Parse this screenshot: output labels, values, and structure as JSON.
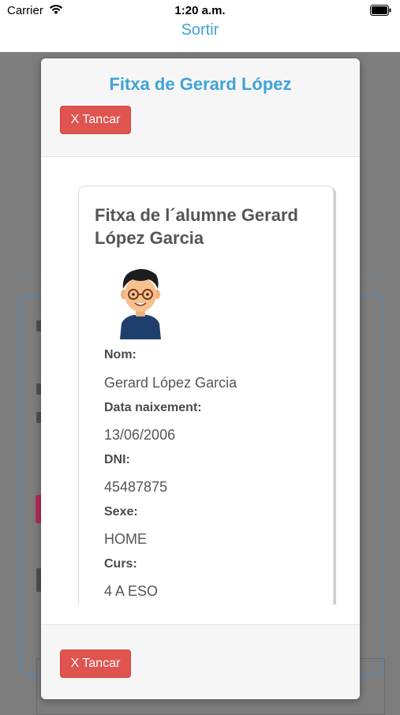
{
  "status_bar": {
    "carrier": "Carrier",
    "time": "1:20 a.m."
  },
  "nav": {
    "sortir_label": "Sortir"
  },
  "modal": {
    "title": "Fitxa de Gerard López",
    "close_label": "X Tancar",
    "card": {
      "title": "Fitxa de l´alumne Gerard López Garcia",
      "fields": [
        {
          "label": "Nom:",
          "value": "Gerard López Garcia"
        },
        {
          "label": "Data naixement:",
          "value": "13/06/2006"
        },
        {
          "label": "DNI:",
          "value": "45487875"
        },
        {
          "label": "Sexe:",
          "value": "HOME"
        },
        {
          "label": "Curs:",
          "value": "4 A ESO"
        }
      ]
    }
  },
  "colors": {
    "accent": "#3ea3da",
    "danger": "#e05450",
    "overlay": "#7d7d7d"
  }
}
